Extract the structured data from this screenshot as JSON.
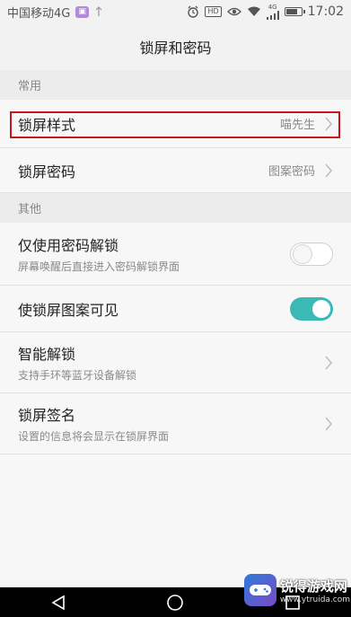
{
  "statusbar": {
    "carrier": "中国移动4G",
    "badge": "▣",
    "hd": "HD",
    "net": "4G",
    "time": "17:02"
  },
  "header": {
    "title": "锁屏和密码"
  },
  "sections": {
    "common": "常用",
    "other": "其他"
  },
  "rows": {
    "lock_style": {
      "title": "锁屏样式",
      "value": "喵先生"
    },
    "lock_password": {
      "title": "锁屏密码",
      "value": "图案密码"
    },
    "password_only": {
      "title": "仅使用密码解锁",
      "sub": "屏幕唤醒后直接进入密码解锁界面",
      "toggle": "off"
    },
    "pattern_visible": {
      "title": "使锁屏图案可见",
      "toggle": "on"
    },
    "smart_unlock": {
      "title": "智能解锁",
      "sub": "支持手环等蓝牙设备解锁"
    },
    "lock_signature": {
      "title": "锁屏签名",
      "sub": "设置的信息将会显示在锁屏界面"
    }
  },
  "watermark": {
    "title": "锐得游戏网",
    "url": "www.ytruida.com"
  },
  "colors": {
    "accent": "#3bbab5",
    "highlight": "#c8161e"
  }
}
